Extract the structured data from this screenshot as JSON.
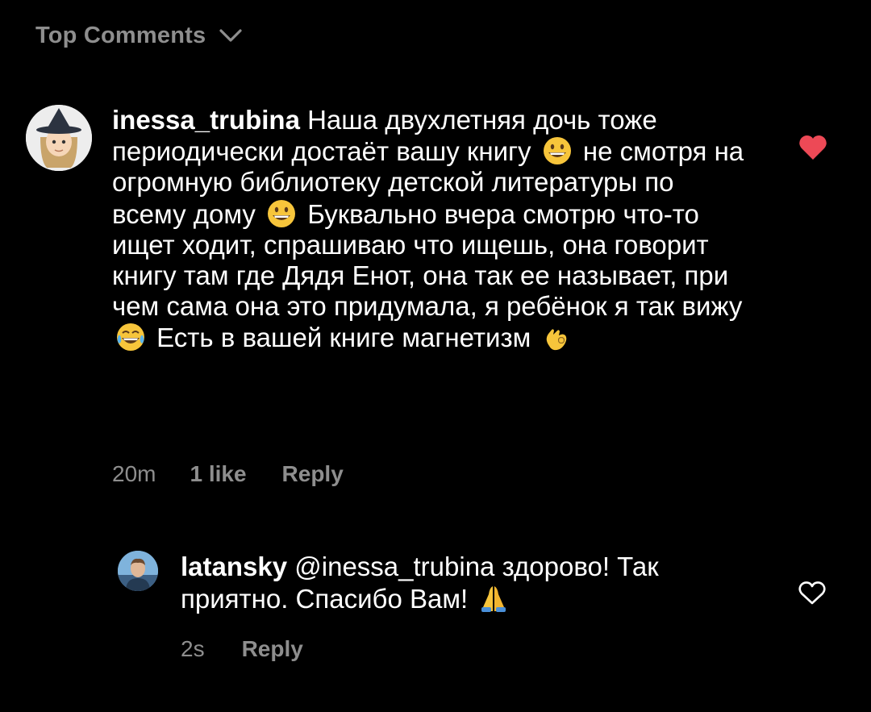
{
  "header": {
    "sort_label": "Top Comments",
    "chevron_icon": "chevron-down-icon"
  },
  "comment": {
    "username": "inessa_trubina",
    "text_1": "Наша двухлетняя дочь тоже периодически достаёт вашу книгу",
    "text_2": "не смотря на огромную библиотеку детской литературы по всему дому",
    "text_3": "Буквально вчера смотрю что-то ищет ходит, спрашиваю что ищешь, она говорит книгу там где Дядя Енот, она так ее называет, при чем сама она это придумала, я ребёнок я так вижу",
    "text_4": "Есть в вашей книге магнетизм",
    "emojis": [
      "grinning-face-emoji",
      "grinning-face-emoji",
      "tears-of-joy-emoji",
      "ok-hand-emoji"
    ],
    "time": "20m",
    "likes": "1 like",
    "reply_label": "Reply",
    "like_icon": "heart-filled-icon",
    "like_color": "#ed4956"
  },
  "reply": {
    "username": "latansky",
    "mention": "@inessa_trubina",
    "text": "здорово! Так приятно. Спасибо Вам!",
    "emoji": "folded-hands-emoji",
    "time": "2s",
    "reply_label": "Reply",
    "like_icon": "heart-outline-icon"
  },
  "colors": {
    "background": "#000000",
    "primary_text": "#ffffff",
    "secondary_text": "#8e8e8e"
  }
}
